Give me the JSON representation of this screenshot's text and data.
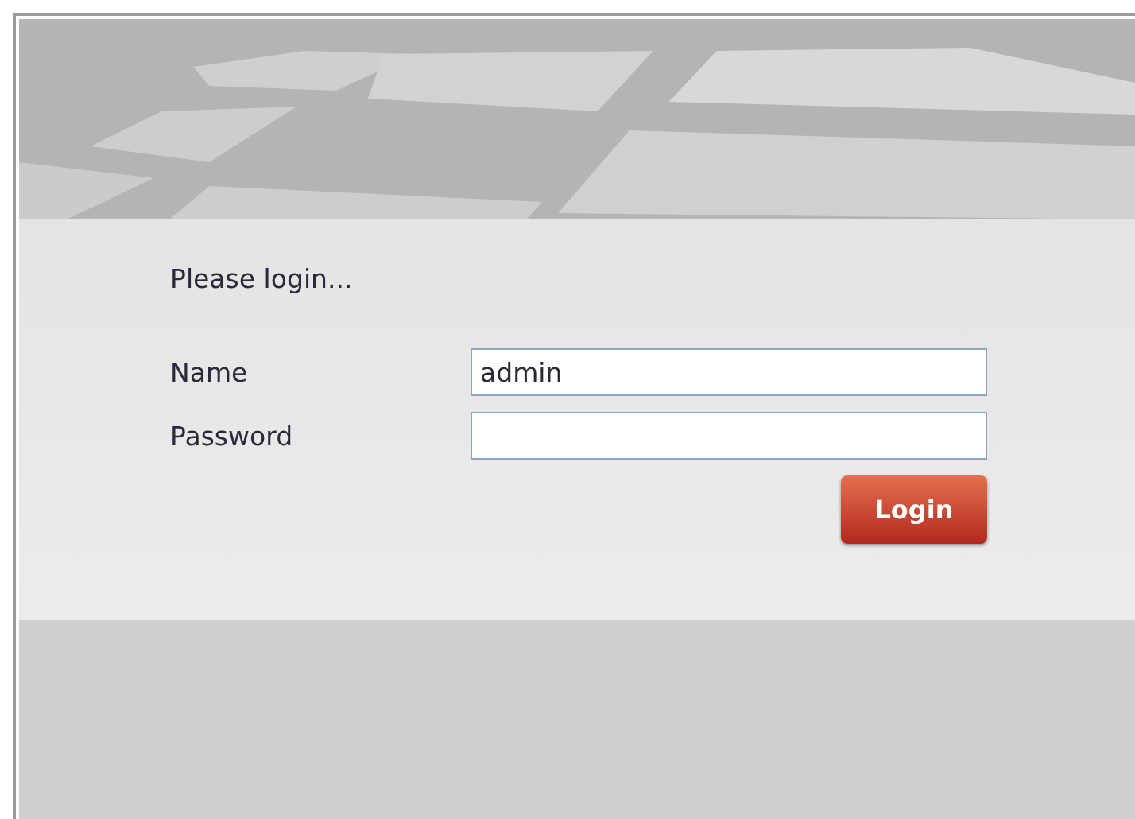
{
  "heading": "Please login...",
  "fields": [
    {
      "label": "Name",
      "value": "admin",
      "kind": "text"
    },
    {
      "label": "Password",
      "kind": "password"
    }
  ],
  "login_button": "Login"
}
